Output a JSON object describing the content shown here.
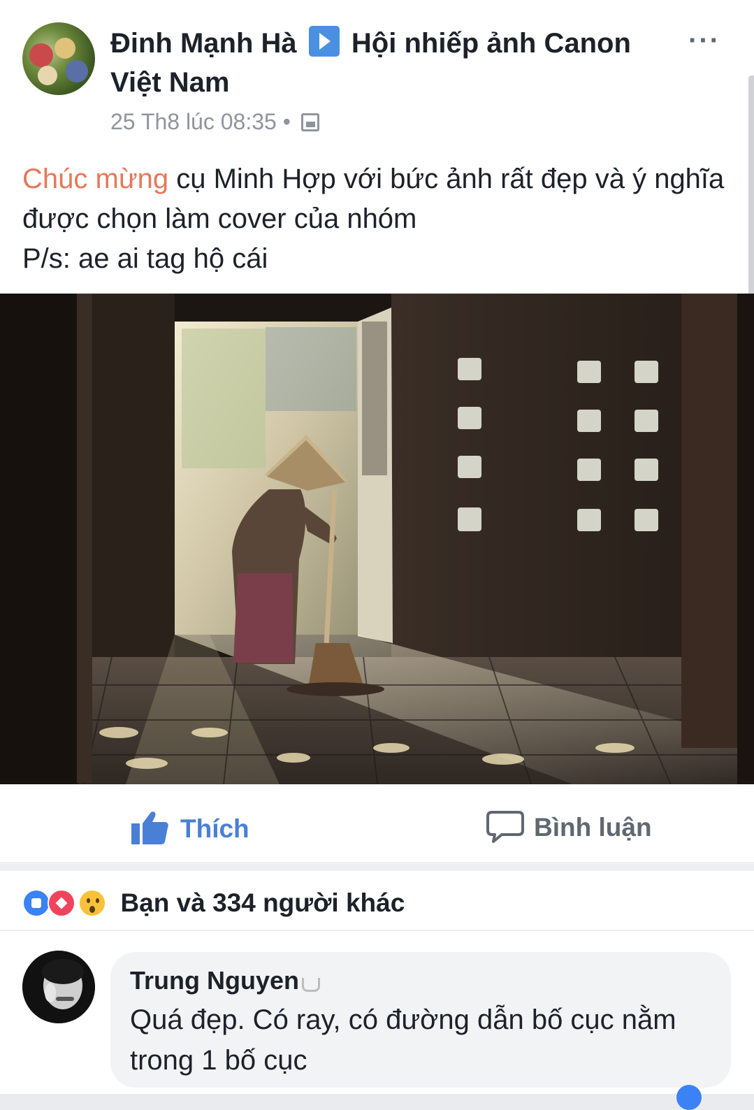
{
  "post": {
    "author": "Đinh Mạnh Hà",
    "group": "Hội nhiếp ảnh Canon Việt Nam",
    "timestamp": "25 Th8 lúc 08:35",
    "separator": "•",
    "privacy_icon": "group-privacy-icon",
    "more_label": "···",
    "text_highlight": "Chúc mừng",
    "text_rest": " cụ Minh Hợp với bức ảnh rất đẹp và ý nghĩa được chọn làm cover của nhóm",
    "text_ps": "P/s: ae ai tag hộ cái"
  },
  "actions": {
    "like_label": "Thích",
    "comment_label": "Bình luận"
  },
  "reactions": {
    "icons": [
      "like-icon",
      "love-icon",
      "wow-icon"
    ],
    "summary": "Bạn và 334 người khác"
  },
  "comment": {
    "author": "Trung Nguyen",
    "text": "Quá đẹp. Có ray, có đường dẫn bố cục nằm trong 1 bố cục"
  },
  "colors": {
    "highlight": "#e6785a",
    "like_blue": "#4a7fd6",
    "meta_gray": "#90949c",
    "bubble_bg": "#f2f3f5"
  }
}
